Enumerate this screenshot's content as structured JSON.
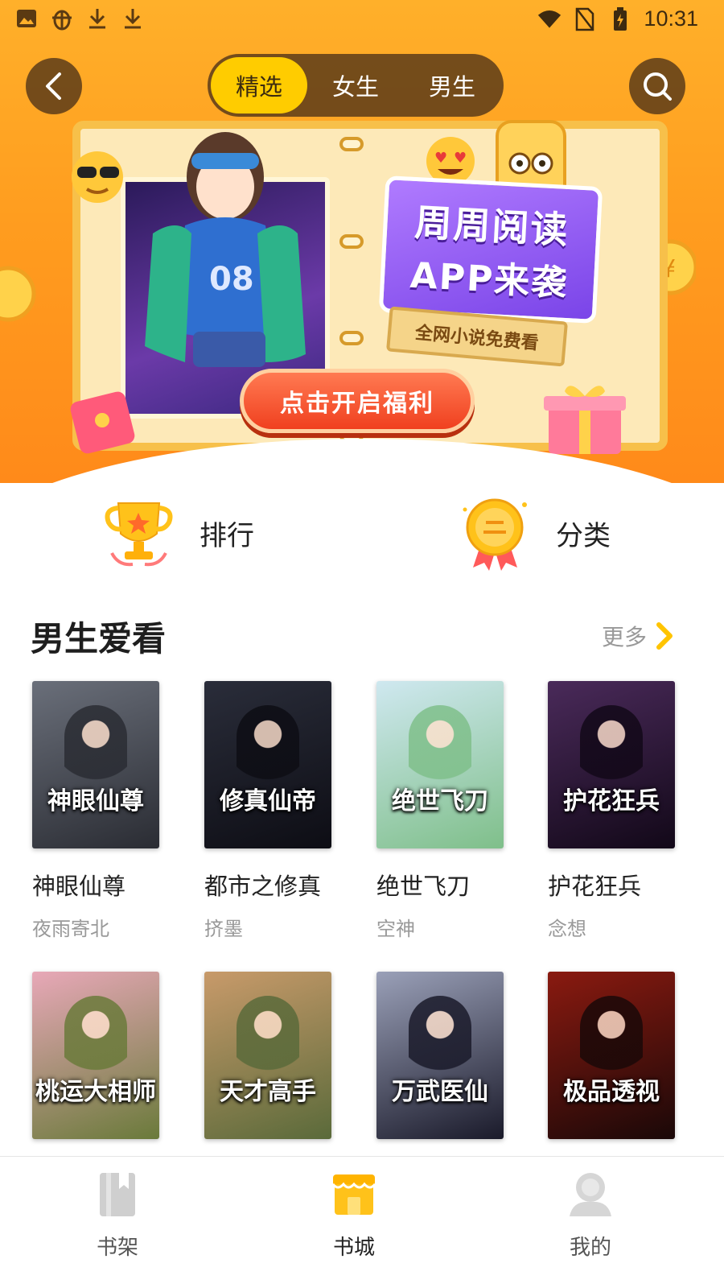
{
  "status_bar": {
    "time": "10:31"
  },
  "header": {
    "tabs": [
      {
        "label": "精选",
        "active": true
      },
      {
        "label": "女生",
        "active": false
      },
      {
        "label": "男生",
        "active": false
      }
    ]
  },
  "banner": {
    "promo_line1": "周周阅读",
    "promo_line2": "APP来袭",
    "promo_sub": "全网小说免费看",
    "cta_label": "点击开启福利"
  },
  "entries": {
    "rank_label": "排行",
    "category_label": "分类"
  },
  "section": {
    "title": "男生爱看",
    "more_label": "更多",
    "books": [
      {
        "title": "神眼仙尊",
        "author": "夜雨寄北",
        "cover_text": "神眼仙尊",
        "cover_colors": [
          "#6a6f7a",
          "#2a2c33"
        ]
      },
      {
        "title": "都市之修真",
        "author": "挤墨",
        "cover_text": "修真仙帝",
        "cover_colors": [
          "#2a2d3a",
          "#0d0d14"
        ]
      },
      {
        "title": "绝世飞刀",
        "author": "空神",
        "cover_text": "绝世飞刀",
        "cover_colors": [
          "#cfe8f0",
          "#7fbf8a"
        ]
      },
      {
        "title": "护花狂兵",
        "author": "念想",
        "cover_text": "护花狂兵",
        "cover_colors": [
          "#4a2a5a",
          "#120818"
        ]
      },
      {
        "cover_text": "桃运大相师",
        "cover_colors": [
          "#e8a8b8",
          "#6a7a3a"
        ]
      },
      {
        "cover_text": "天才高手",
        "cover_colors": [
          "#c89a6a",
          "#5a6a3a"
        ]
      },
      {
        "cover_text": "万武医仙",
        "cover_colors": [
          "#9aa0b8",
          "#1a1a2a"
        ]
      },
      {
        "cover_text": "极品透视",
        "cover_colors": [
          "#8a1a10",
          "#1a0808"
        ]
      }
    ]
  },
  "bottom_nav": {
    "items": [
      {
        "label": "书架",
        "active": false
      },
      {
        "label": "书城",
        "active": true
      },
      {
        "label": "我的",
        "active": false
      }
    ]
  },
  "colors": {
    "accent": "#ffcc00",
    "banner": "#ff9d1f",
    "cta": "#f0401f"
  },
  "icons": [
    "image-icon",
    "bug-icon",
    "download-icon",
    "wifi-icon",
    "no-sim-icon",
    "battery-icon",
    "back-arrow-icon",
    "search-icon",
    "trophy-icon",
    "medal-icon",
    "chevron-right-icon",
    "bookshelf-icon",
    "store-icon",
    "profile-icon"
  ]
}
